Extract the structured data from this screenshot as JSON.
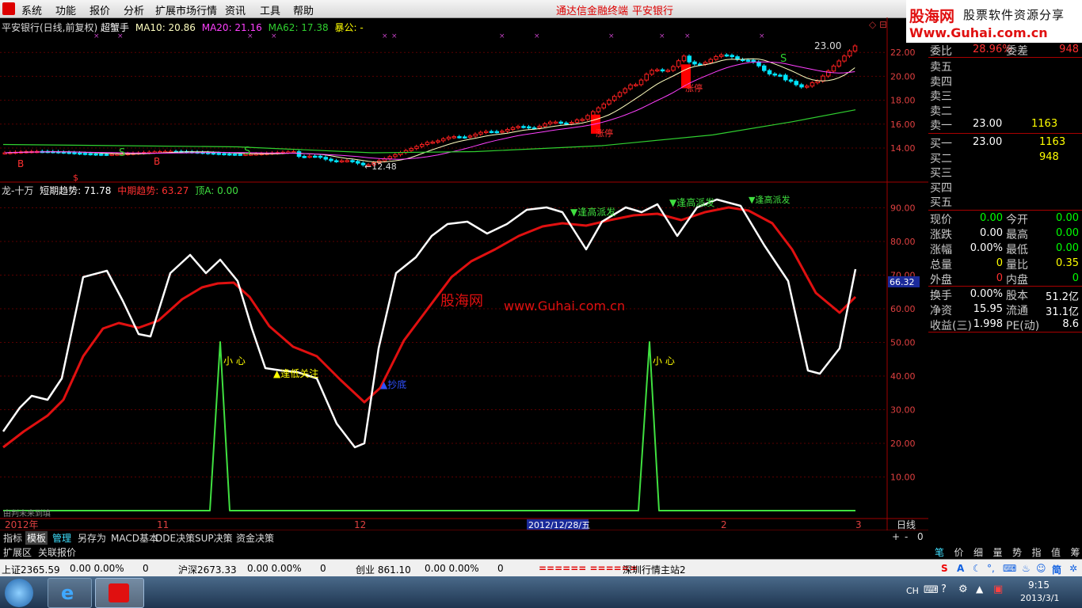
{
  "menu": {
    "items": [
      "系统",
      "功能",
      "报价",
      "分析",
      "扩展市场行情",
      "资讯",
      "工具",
      "帮助"
    ],
    "center_links": [
      "通达信金融终端",
      "平安银行"
    ]
  },
  "logo": {
    "line1": "股海网",
    "line2": "股票软件资源分享",
    "line3": "Www.Guhai.com.cn"
  },
  "price_panel": {
    "title": "平安银行(日线,前复权)",
    "formula": "超蟹手",
    "ma10": "MA10: 20.86",
    "ma20": "MA20: 21.16",
    "ma62": "MA62: 17.38",
    "extra": "暴公: -",
    "y_ticks": [
      "22.00",
      "20.00",
      "18.00",
      "16.00",
      "14.00"
    ],
    "annotations": {
      "high": "23.00",
      "low": "12.48",
      "zt1": "涨停",
      "zt2": "涨停",
      "s": "S",
      "b": "B"
    }
  },
  "ind_panel": {
    "name": "龙-十万",
    "short": "短期趋势: 71.78",
    "mid": "中期趋势: 63.27",
    "top": "顶A: 0.00",
    "y_ticks": [
      "90.00",
      "80.00",
      "70.00",
      "60.00",
      "50.00",
      "40.00",
      "30.00",
      "20.00",
      "10.00"
    ],
    "current": "66.32",
    "labels": {
      "xin1": "小 心",
      "xin2": "小 心",
      "attention": "▲逢低关注",
      "buy": "▲抄底",
      "sell1": "▼逢高派发",
      "sell2": "▼逢高派发",
      "sell3": "▼逢高派发"
    },
    "corner": "由判未来到填",
    "watermark1": "股海网",
    "watermark2": "www.Guhai.com.cn"
  },
  "x_axis": {
    "y2012": "2012年",
    "m11": "11",
    "m12": "12",
    "cursor": "2012/12/28/五",
    "m2": "2",
    "m3": "3",
    "period": "日线"
  },
  "tabs1": [
    "指标",
    "模板",
    "管理",
    "另存为",
    "MACD基本",
    "DDE决策",
    "SUP决策",
    "资金决策"
  ],
  "tabs1_ctrl": [
    "+",
    "-",
    "0"
  ],
  "tabs2": [
    "扩展区",
    "关联报价"
  ],
  "rtabs": [
    "笔",
    "价",
    "细",
    "量",
    "势",
    "指",
    "值",
    "筹"
  ],
  "quote": {
    "wb_label": "委比",
    "wb_val": "28.96%",
    "wc_label": "委差",
    "wc_val": "948",
    "sell": [
      {
        "label": "卖五",
        "price": "",
        "vol": ""
      },
      {
        "label": "卖四",
        "price": "",
        "vol": ""
      },
      {
        "label": "卖三",
        "price": "",
        "vol": ""
      },
      {
        "label": "卖二",
        "price": "",
        "vol": ""
      },
      {
        "label": "卖一",
        "price": "23.00",
        "vol": "1163"
      }
    ],
    "buy": [
      {
        "label": "买一",
        "price": "23.00",
        "vol": "1163"
      },
      {
        "label": "买二",
        "price": "",
        "vol": "948"
      },
      {
        "label": "买三",
        "price": "",
        "vol": ""
      },
      {
        "label": "买四",
        "price": "",
        "vol": ""
      },
      {
        "label": "买五",
        "price": "",
        "vol": ""
      }
    ],
    "stats": [
      {
        "l1": "现价",
        "v1": "0.00",
        "l2": "今开",
        "v2": "0.00",
        "c1": "#00ff00",
        "c2": "#00ff00"
      },
      {
        "l1": "涨跌",
        "v1": "0.00",
        "l2": "最高",
        "v2": "0.00",
        "c1": "#ffffff",
        "c2": "#00ff00"
      },
      {
        "l1": "涨幅",
        "v1": "0.00%",
        "l2": "最低",
        "v2": "0.00",
        "c1": "#ffffff",
        "c2": "#00ff00"
      },
      {
        "l1": "总量",
        "v1": "0",
        "l2": "量比",
        "v2": "0.35",
        "c1": "#ffff00",
        "c2": "#ffff00"
      },
      {
        "l1": "外盘",
        "v1": "0",
        "l2": "内盘",
        "v2": "0",
        "c1": "#ff3030",
        "c2": "#00ff00"
      }
    ],
    "fund": [
      {
        "l1": "换手",
        "v1": "0.00%",
        "l2": "股本",
        "v2": "51.2亿"
      },
      {
        "l1": "净资",
        "v1": "15.95",
        "l2": "流通",
        "v2": "31.1亿"
      },
      {
        "l1": "收益(三)",
        "v1": "1.998",
        "l2": "PE(动)",
        "v2": "8.6"
      }
    ]
  },
  "status": {
    "sh": "上证2365.59",
    "sh_v": "0.00  0.00%",
    "sh_n": "0",
    "hs": "沪深2673.33",
    "hs_v": "0.00  0.00%",
    "hs_n": "0",
    "cy": "创业  861.10",
    "cy_v": "0.00  0.00%",
    "cy_n": "0",
    "bars": "====== ======",
    "station": "深圳行情主站2"
  },
  "taskbar": {
    "lang": "CH",
    "time": "9:15",
    "date": "2013/3/1"
  },
  "colors": {
    "up": "#ff2020",
    "down": "#00e5ff",
    "ma10": "#ffffc0",
    "ma20": "#ff40ff",
    "ma62": "#30d030",
    "short": "#ffffff",
    "mid": "#e01010",
    "top": "#40e040",
    "grid": "#5a0000"
  }
}
